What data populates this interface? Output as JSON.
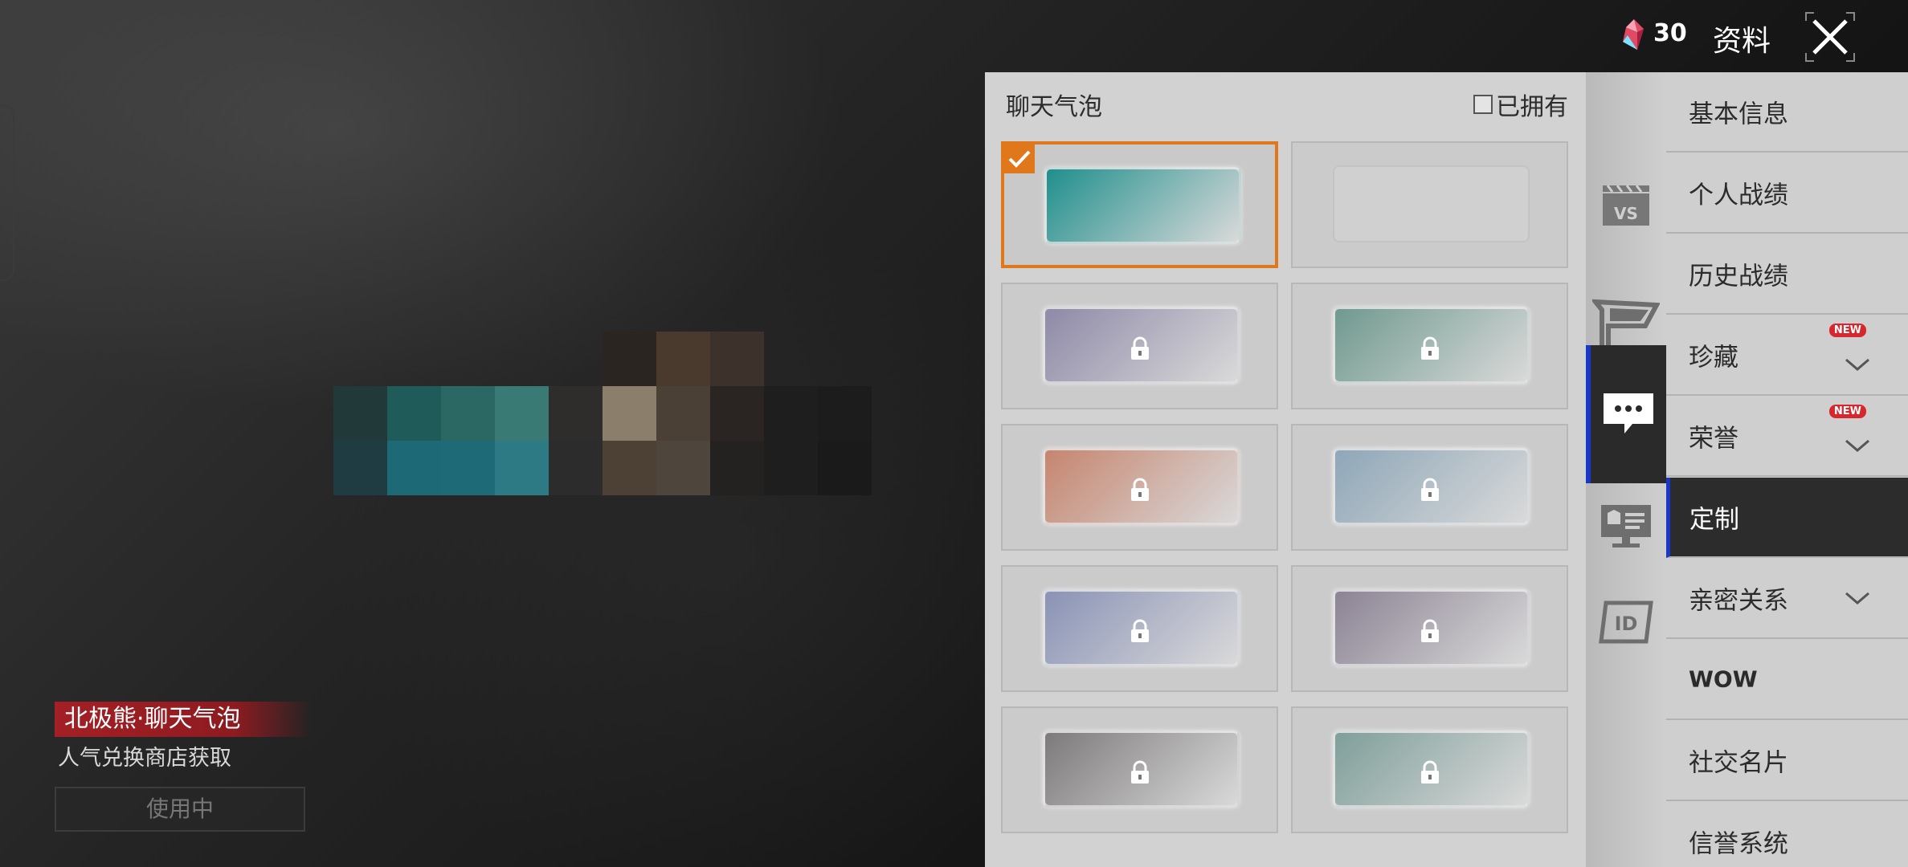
{
  "topbar": {
    "currency_icon": "crystal-icon",
    "currency_value": "30",
    "title": "资料",
    "close_icon": "close-icon"
  },
  "item": {
    "name": "北极熊·聊天气泡",
    "source": "人气兑换商店获取",
    "use_button": "使用中"
  },
  "panel": {
    "title": "聊天气泡",
    "owned_filter_label": "已拥有",
    "owned_checked": false,
    "bubbles": [
      {
        "name": "arctic-bear-bubble",
        "locked": false,
        "selected": true,
        "color": "#1f8f8c"
      },
      {
        "name": "empty-bubble-slot",
        "locked": false,
        "selected": false,
        "color": "#cfcfcf"
      },
      {
        "name": "purple-bubble",
        "locked": true,
        "selected": false,
        "color": "#8e8aa8"
      },
      {
        "name": "lion-bubble",
        "locked": true,
        "selected": false,
        "color": "#6f9a8f"
      },
      {
        "name": "snowboard-bubble",
        "locked": true,
        "selected": false,
        "color": "#c6856f"
      },
      {
        "name": "wolf-bubble",
        "locked": true,
        "selected": false,
        "color": "#8ea7b8"
      },
      {
        "name": "lantern-bubble",
        "locked": true,
        "selected": false,
        "color": "#8a93b6"
      },
      {
        "name": "mauve-bubble",
        "locked": true,
        "selected": false,
        "color": "#8c8394"
      },
      {
        "name": "cat-bubble",
        "locked": true,
        "selected": false,
        "color": "#7d7a7c"
      },
      {
        "name": "goggles-bubble",
        "locked": true,
        "selected": false,
        "color": "#7f9f9a"
      }
    ]
  },
  "rail": [
    {
      "name": "rail-vs-icon",
      "active": false
    },
    {
      "name": "rail-flag-icon",
      "active": false
    },
    {
      "name": "rail-chat-icon",
      "active": true
    },
    {
      "name": "rail-display-icon",
      "active": false
    },
    {
      "name": "rail-id-icon",
      "active": false
    }
  ],
  "menu": [
    {
      "name": "menu-basic-info",
      "label": "基本信息",
      "chevron": false,
      "new": false,
      "active": false
    },
    {
      "name": "menu-personal-stats",
      "label": "个人战绩",
      "chevron": false,
      "new": false,
      "active": false
    },
    {
      "name": "menu-history-stats",
      "label": "历史战绩",
      "chevron": false,
      "new": false,
      "active": false
    },
    {
      "name": "menu-collection",
      "label": "珍藏",
      "chevron": true,
      "new": true,
      "active": false
    },
    {
      "name": "menu-honor",
      "label": "荣誉",
      "chevron": true,
      "new": true,
      "active": false
    },
    {
      "name": "menu-custom",
      "label": "定制",
      "chevron": false,
      "new": false,
      "active": true
    },
    {
      "name": "menu-relationship",
      "label": "亲密关系",
      "chevron": true,
      "new": false,
      "active": false
    },
    {
      "name": "menu-wow",
      "label": "WOW",
      "chevron": false,
      "new": false,
      "active": false
    },
    {
      "name": "menu-social-card",
      "label": "社交名片",
      "chevron": false,
      "new": false,
      "active": false
    },
    {
      "name": "menu-reputation",
      "label": "信誉系统",
      "chevron": false,
      "new": false,
      "active": false
    }
  ],
  "new_badge_text": "NEW"
}
